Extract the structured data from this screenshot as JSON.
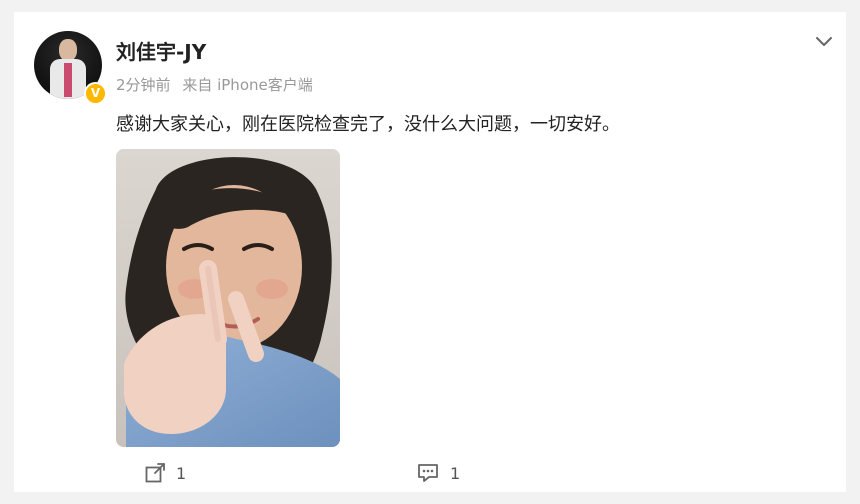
{
  "post": {
    "username": "刘佳宇-JY",
    "time": "2分钟前",
    "source": "来自 iPhone客户端",
    "text": "感谢大家关心，刚在医院检查完了，没什么大问题，一切安好。",
    "verified_badge": "V",
    "menu_icon": "chevron-down-icon",
    "avatar_icon": "user-avatar",
    "photo_subject": "selfie"
  },
  "actions": {
    "share_icon": "share-icon",
    "share_count": "1",
    "comment_icon": "comment-icon",
    "comment_count": "1"
  },
  "colors": {
    "verified": "#ffb800",
    "text_primary": "#222222",
    "text_secondary": "#999999"
  }
}
